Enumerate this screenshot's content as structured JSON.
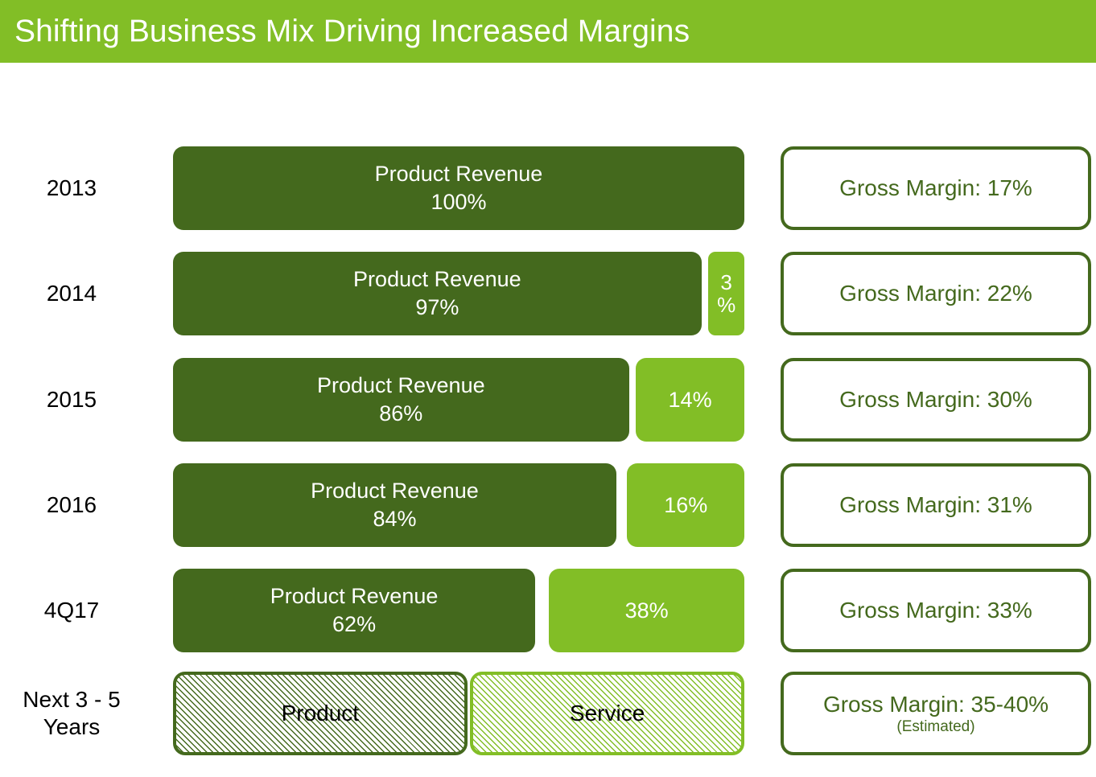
{
  "header": {
    "title": "Shifting Business Mix Driving Increased Margins",
    "background_color": "#82be26",
    "text_color": "#ffffff"
  },
  "colors": {
    "product_green": "#44691d",
    "service_green": "#82be26",
    "callout_border": "#44691d",
    "callout_text": "#44691d",
    "label_text": "#000000",
    "page_background": "#ffffff"
  },
  "chart_data": {
    "type": "bar",
    "title": "Shifting Business Mix Driving Increased Margins",
    "xlabel": "",
    "ylabel": "",
    "orientation": "horizontal",
    "stacked": true,
    "xlim": [
      0,
      100
    ],
    "grid": false,
    "legend_position": "none",
    "categories": [
      "2013",
      "2014",
      "2015",
      "2016",
      "4Q17",
      "Next 3 - 5 Years"
    ],
    "series": [
      {
        "name": "Product Revenue",
        "values": [
          100,
          97,
          86,
          84,
          62,
          null
        ]
      },
      {
        "name": "Service Revenue",
        "values": [
          0,
          3,
          14,
          16,
          38,
          null
        ]
      }
    ],
    "annotations": [
      "Gross Margin: 17%",
      "Gross Margin: 22%",
      "Gross Margin: 30%",
      "Gross Margin: 31%",
      "Gross Margin: 33%",
      "Gross Margin: 35-40% (Estimated)"
    ]
  },
  "rows": [
    {
      "label": "2013",
      "product": {
        "name": "Product Revenue",
        "value_text": "100%",
        "width_pct": 100,
        "show": true
      },
      "service": {
        "value_text": "",
        "width_pct": 0,
        "show": false,
        "narrow": false
      },
      "margin": {
        "main": "Gross Margin: 17%",
        "sub": ""
      }
    },
    {
      "label": "2014",
      "product": {
        "name": "Product Revenue",
        "value_text": "97%",
        "width_pct": 92.5,
        "show": true
      },
      "service": {
        "value_text": "3\n%",
        "width_pct": 6.3,
        "show": true,
        "narrow": true
      },
      "margin": {
        "main": "Gross Margin: 22%",
        "sub": ""
      }
    },
    {
      "label": "2015",
      "product": {
        "name": "Product Revenue",
        "value_text": "86%",
        "width_pct": 79.8,
        "show": true
      },
      "service": {
        "value_text": "14%",
        "width_pct": 19.0,
        "show": true,
        "narrow": false
      },
      "margin": {
        "main": "Gross Margin: 30%",
        "sub": ""
      }
    },
    {
      "label": "2016",
      "product": {
        "name": "Product Revenue",
        "value_text": "84%",
        "width_pct": 77.6,
        "show": true
      },
      "service": {
        "value_text": "16%",
        "width_pct": 20.5,
        "show": true,
        "narrow": false
      },
      "margin": {
        "main": "Gross Margin: 31%",
        "sub": ""
      }
    },
    {
      "label": "4Q17",
      "product": {
        "name": "Product Revenue",
        "value_text": "62%",
        "width_pct": 63.4,
        "show": true
      },
      "service": {
        "value_text": "38%",
        "width_pct": 34.2,
        "show": true,
        "narrow": false
      },
      "margin": {
        "main": "Gross Margin: 33%",
        "sub": ""
      }
    },
    {
      "label": "Next 3 - 5\nYears",
      "product": {
        "name": "Product",
        "value_text": "",
        "width_pct": 51.5,
        "show": true,
        "hatched": true
      },
      "service": {
        "value_text": "Service",
        "width_pct": 48.0,
        "show": true,
        "narrow": false,
        "hatched": true
      },
      "margin": {
        "main": "Gross Margin: 35-40%",
        "sub": "(Estimated)"
      }
    }
  ]
}
